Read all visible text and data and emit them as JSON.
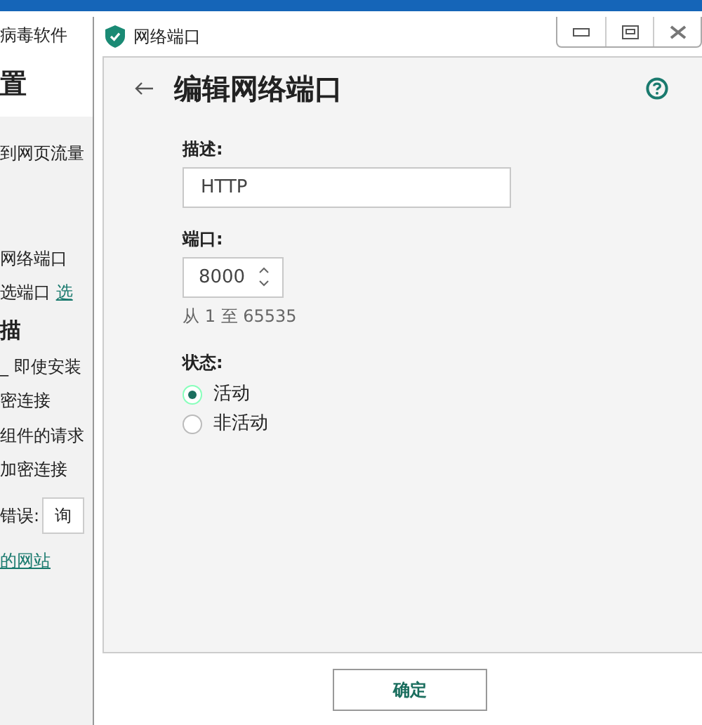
{
  "background_window": {
    "title": "病毒软件",
    "heading": "置",
    "items": [
      {
        "kind": "text",
        "text": "到网页流量"
      },
      {
        "kind": "gap"
      },
      {
        "kind": "text",
        "text": "网络端口"
      },
      {
        "kind": "text_link",
        "text": "选端口",
        "link": "选"
      },
      {
        "kind": "section",
        "text": "描"
      },
      {
        "kind": "text",
        "text": "_ 即使安装"
      },
      {
        "kind": "text",
        "text": "密连接"
      },
      {
        "kind": "text",
        "text": "组件的请求"
      },
      {
        "kind": "text",
        "text": "加密连接"
      },
      {
        "kind": "dropdown",
        "text": "错误:",
        "value": "询"
      },
      {
        "kind": "link",
        "text": "的网站"
      }
    ]
  },
  "dialog": {
    "title": "网络端口",
    "heading": "编辑网络端口",
    "description": {
      "label": "描述:",
      "value": "HTTP"
    },
    "port": {
      "label": "端口:",
      "value": "8000",
      "hint": "从 1 至 65535"
    },
    "status": {
      "label": "状态:",
      "options": [
        {
          "label": "活动",
          "selected": true
        },
        {
          "label": "非活动",
          "selected": false
        }
      ]
    },
    "buttons": [
      "确定"
    ]
  }
}
